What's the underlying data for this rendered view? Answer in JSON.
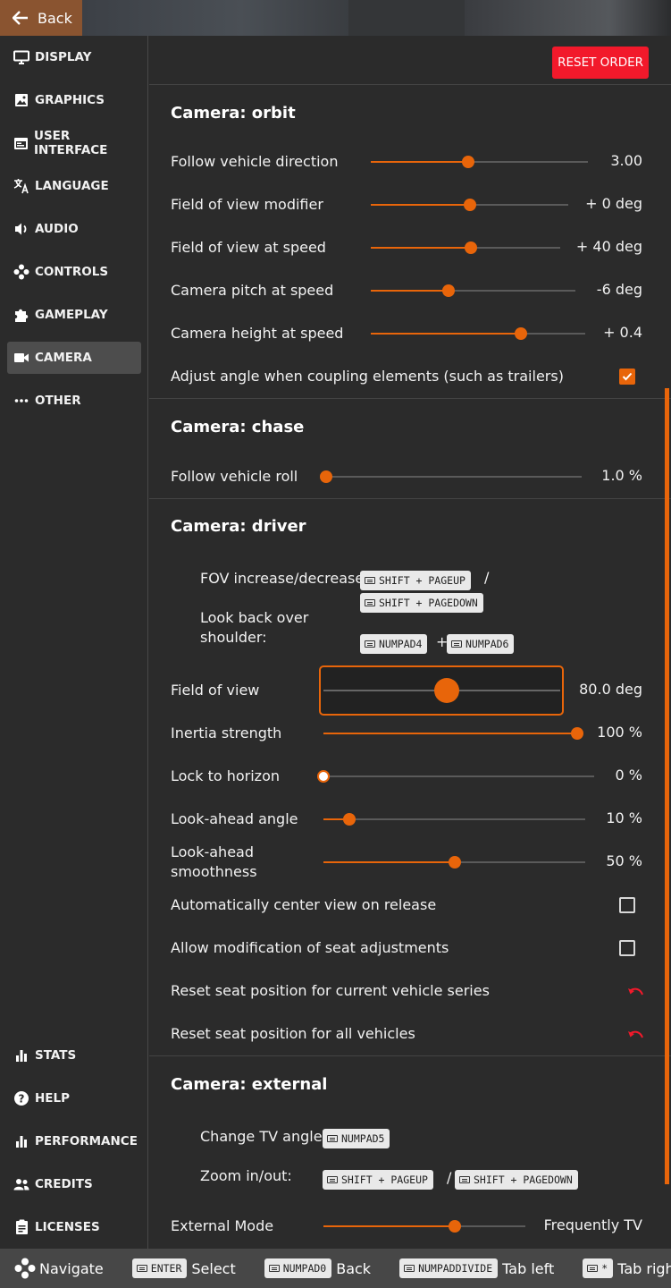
{
  "topbar": {
    "back_label": "Back"
  },
  "sidebar": {
    "items": [
      {
        "label": "DISPLAY",
        "icon": "monitor-icon"
      },
      {
        "label": "GRAPHICS",
        "icon": "image-icon"
      },
      {
        "label": "USER INTERFACE",
        "icon": "window-icon"
      },
      {
        "label": "LANGUAGE",
        "icon": "translate-icon"
      },
      {
        "label": "AUDIO",
        "icon": "speaker-icon"
      },
      {
        "label": "CONTROLS",
        "icon": "dpad-icon"
      },
      {
        "label": "GAMEPLAY",
        "icon": "puzzle-icon"
      },
      {
        "label": "CAMERA",
        "icon": "video-camera-icon",
        "active": true
      },
      {
        "label": "OTHER",
        "icon": "more-dots-icon"
      }
    ],
    "bottom_items": [
      {
        "label": "STATS",
        "icon": "bar-chart-icon"
      },
      {
        "label": "HELP",
        "icon": "help-icon"
      },
      {
        "label": "PERFORMANCE",
        "icon": "bar-chart-icon"
      },
      {
        "label": "CREDITS",
        "icon": "people-icon"
      },
      {
        "label": "LICENSES",
        "icon": "document-icon"
      }
    ]
  },
  "main": {
    "reset_order_label": "RESET ORDER",
    "orbit": {
      "title": "Camera: orbit",
      "rows": [
        {
          "label": "Follow vehicle direction",
          "value": "3.00",
          "level": 0.45
        },
        {
          "label": "Field of view modifier",
          "value": "+ 0 deg",
          "level": 0.5
        },
        {
          "label": "Field of view at speed",
          "value": "+ 40 deg",
          "level": 0.53
        },
        {
          "label": "Camera pitch at speed",
          "value": "-6 deg",
          "level": 0.38
        },
        {
          "label": "Camera height at speed",
          "value": "+ 0.4",
          "level": 0.7
        }
      ],
      "adjust_label": "Adjust angle when coupling elements (such as trailers)",
      "adjust_checked": true
    },
    "chase": {
      "title": "Camera: chase",
      "roll_label": "Follow vehicle roll",
      "roll_value": "1.0 %",
      "roll_level": 0.01
    },
    "driver": {
      "title": "Camera: driver",
      "fov_binding_label": "FOV increase/decrease:",
      "fov_key1": "SHIFT + PAGEUP",
      "fov_sep": "/",
      "fov_key2": "SHIFT + PAGEDOWN",
      "lookback_label_line1": "Look back over",
      "lookback_label_line2": "shoulder:",
      "lookback_key1": "NUMPAD4",
      "lookback_plus": "+",
      "lookback_key2": "NUMPAD6",
      "rows": [
        {
          "label": "Field of view",
          "value": "80.0 deg",
          "level": 0.52
        },
        {
          "label": "Inertia strength",
          "value": "100 %",
          "level": 1.0
        },
        {
          "label": "Lock to horizon",
          "value": "0 %",
          "level": 0.0
        },
        {
          "label": "Look-ahead angle",
          "value": "10 %",
          "level": 0.1
        },
        {
          "label_line1": "Look-ahead",
          "label_line2": "smoothness",
          "value": "50 %",
          "level": 0.5
        }
      ],
      "auto_center_label": "Automatically center view on release",
      "auto_center_checked": false,
      "seat_mod_label": "Allow modification of seat adjustments",
      "seat_mod_checked": false,
      "reset_series_label": "Reset seat position for current vehicle series",
      "reset_all_label": "Reset seat position for all vehicles"
    },
    "external": {
      "title": "Camera: external",
      "tv_label": "Change TV angle:",
      "tv_key": "NUMPAD5",
      "zoom_label": "Zoom in/out:",
      "zoom_key1": "SHIFT + PAGEUP",
      "zoom_sep": "/",
      "zoom_key2": "SHIFT + PAGEDOWN",
      "mode_label": "External Mode",
      "mode_value": "Frequently TV",
      "mode_level": 0.65
    }
  },
  "bottombar": {
    "navigate": "Navigate",
    "enter_key": "ENTER",
    "select": "Select",
    "numpad0_key": "NUMPAD0",
    "back": "Back",
    "divide_key": "NUMPADDIVIDE",
    "tab_left": "Tab left",
    "star_key": "*",
    "tab_right": "Tab right"
  },
  "colors": {
    "accent": "#e8650a",
    "reset": "#f2192b",
    "back_button": "#8a5430"
  }
}
